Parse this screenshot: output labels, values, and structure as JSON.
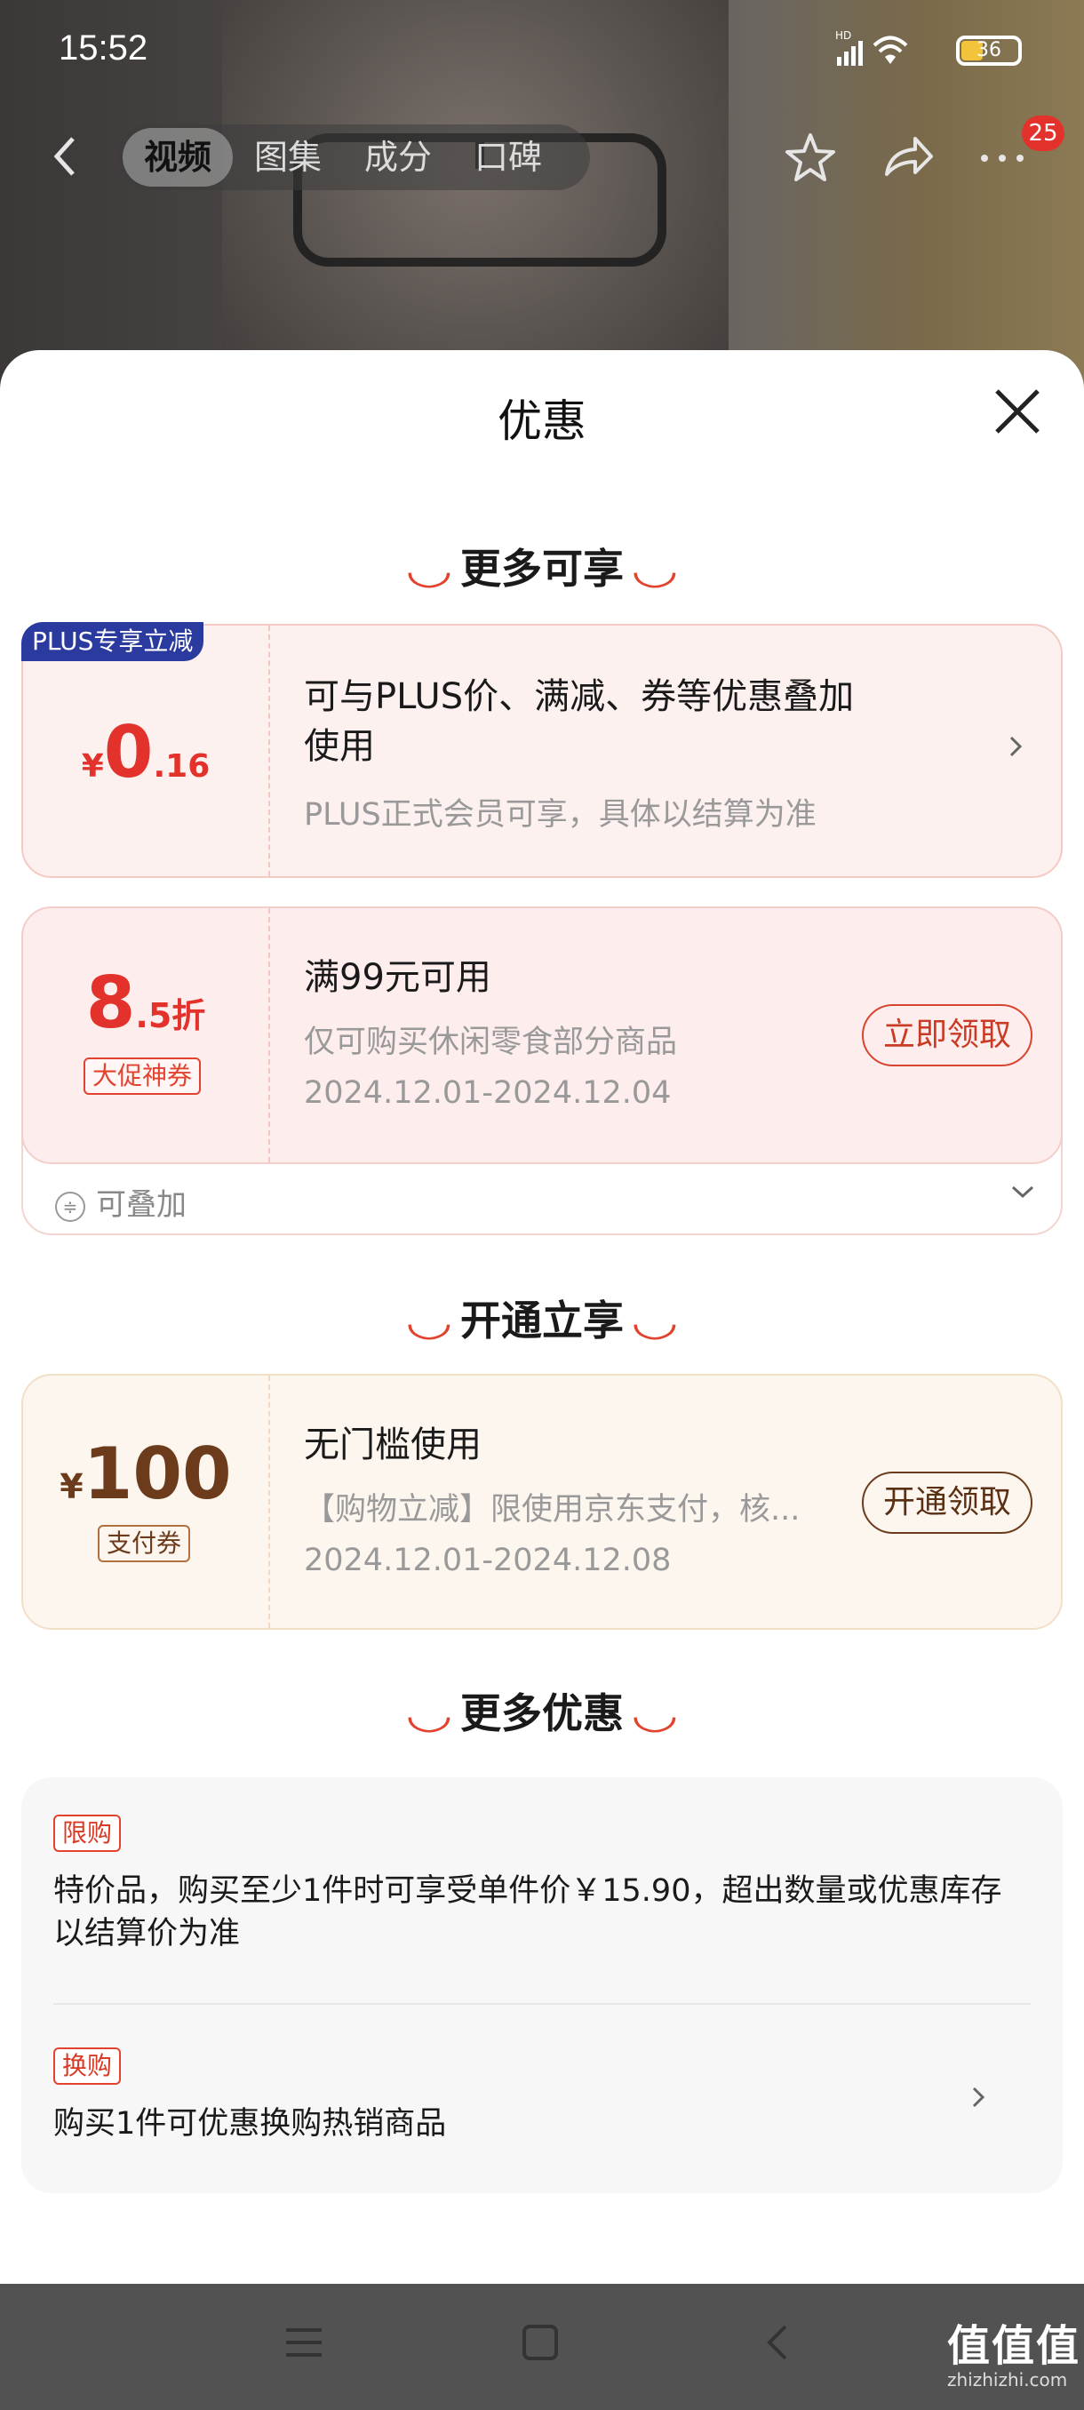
{
  "status_bar": {
    "time": "15:52",
    "battery": "36"
  },
  "nav": {
    "tabs": [
      {
        "label": "视频"
      },
      {
        "label": "图集"
      },
      {
        "label": "成分"
      },
      {
        "label": "口碑"
      }
    ],
    "badge": "25"
  },
  "sheet": {
    "title": "优惠",
    "section1_title": "更多可享",
    "plus_card": {
      "tag": "PLUS专享立减",
      "currency": "¥",
      "amount_int": "0",
      "amount_dec": ".16",
      "desc_line1": "可与PLUS价、满减、券等优惠叠加",
      "desc_line2": "使用",
      "note": "PLUS正式会员可享，具体以结算为准"
    },
    "discount_card": {
      "value_int": "8",
      "value_unit": ".5折",
      "tag": "大促神券",
      "condition": "满99元可用",
      "scope": "仅可购买休闲零食部分商品",
      "dates": "2024.12.01-2024.12.04",
      "button": "立即领取",
      "stack_label": "可叠加"
    },
    "section2_title": "开通立享",
    "pay_card": {
      "currency": "¥",
      "amount": "100",
      "tag": "支付券",
      "condition": "无门槛使用",
      "desc": "【购物立减】限使用京东支付，核...",
      "dates": "2024.12.01-2024.12.08",
      "button": "开通领取"
    },
    "section3_title": "更多优惠",
    "more": [
      {
        "tag": "限购",
        "text": "特价品，购买至少1件时可享受单件价￥15.90，超出数量或优惠库存以结算价为准"
      },
      {
        "tag": "换购",
        "text": "购买1件可优惠换购热销商品"
      }
    ]
  },
  "watermark": {
    "main": "值值值",
    "sub": "zhizhizhi.com"
  }
}
